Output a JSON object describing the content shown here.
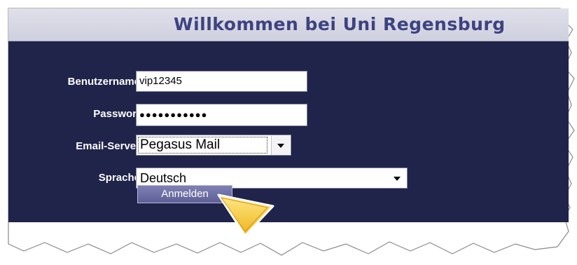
{
  "header": {
    "title": "Willkommen bei Uni Regensburg"
  },
  "form": {
    "username_label": "Benutzername",
    "username_value": "vip12345",
    "password_label": "Passwort",
    "password_value": "●●●●●●●●●●●",
    "server_label": "Email-Server",
    "server_value": "Pegasus Mail",
    "language_label": "Sprache",
    "language_value": "Deutsch",
    "login_button": "Anmelden"
  },
  "colors": {
    "header_text": "#3e4280",
    "form_background": "#20234a",
    "button": "#6c6da6",
    "cursor": "#f5cc3c"
  },
  "icons": [
    "dropdown-arrow-icon",
    "pointer-cursor-icon"
  ]
}
